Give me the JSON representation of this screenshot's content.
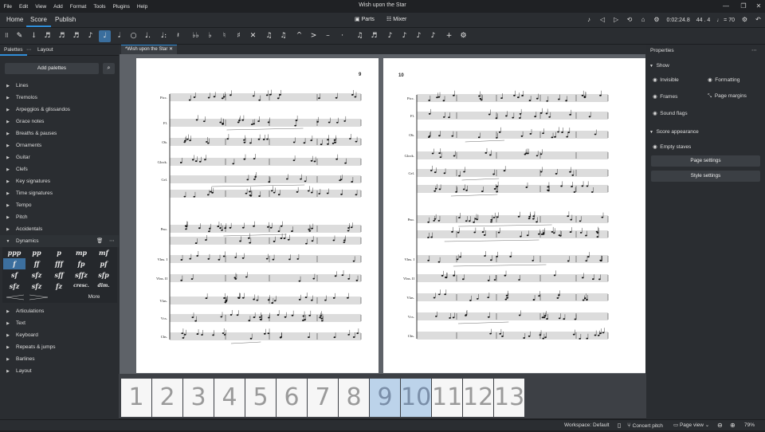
{
  "menu": [
    "File",
    "Edit",
    "View",
    "Add",
    "Format",
    "Tools",
    "Plugins",
    "Help"
  ],
  "window_title": "Wish upon the Star",
  "main_tabs": [
    "Home",
    "Score",
    "Publish"
  ],
  "top_center": {
    "parts": "Parts",
    "mixer": "Mixer"
  },
  "playback": {
    "time": "0:02:24.8",
    "measure": "44 . 4",
    "tempo": "♩ = 70"
  },
  "palettes_tab": "Palettes",
  "layout_tab": "Layout",
  "add_palettes": "Add palettes",
  "palettes": [
    "Lines",
    "Tremolos",
    "Arpeggios & glissandos",
    "Grace notes",
    "Breaths & pauses",
    "Ornaments",
    "Guitar",
    "Clefs",
    "Key signatures",
    "Time signatures",
    "Tempo",
    "Pitch",
    "Accidentals",
    "Dynamics"
  ],
  "palettes_after": [
    "Articulations",
    "Text",
    "Keyboard",
    "Repeats & jumps",
    "Barlines",
    "Layout"
  ],
  "dynamics_cells": [
    "ppp",
    "pp",
    "p",
    "mp",
    "mf",
    "f",
    "ff",
    "fff",
    "fp",
    "pf",
    "sf",
    "sfz",
    "sff",
    "sffz",
    "sfp",
    "sfz",
    "sfz",
    "fz",
    "cresc.",
    "dim."
  ],
  "dynamics_more": "More",
  "doc_tab": "*Wish upon the Star",
  "page_numbers": {
    "left": "9",
    "right": "10"
  },
  "instruments_left": [
    "Picc.",
    "Fl.",
    "Ob.",
    "Glock.",
    "Cel.",
    "Pno.",
    "Vlns. I",
    "Vlns. II",
    "Vlas.",
    "Vcs.",
    "Cbs."
  ],
  "instruments_right": [
    "Picc.",
    "Fl.",
    "Ob.",
    "Glock.",
    "Cel.",
    "Pno.",
    "Vlns. I",
    "Vlns. II",
    "Vlas.",
    "Vcs.",
    "Cbs."
  ],
  "thumbnails": [
    "1",
    "2",
    "3",
    "4",
    "5",
    "6",
    "7",
    "8",
    "9",
    "10",
    "11",
    "12",
    "13"
  ],
  "properties": {
    "title": "Properties",
    "show_header": "Show",
    "toggles": [
      "Invisible",
      "Formatting",
      "Frames",
      "Page margins",
      "Sound flags"
    ],
    "score_appearance": "Score appearance",
    "empty_staves": "Empty staves",
    "page_settings": "Page settings",
    "style_settings": "Style settings"
  },
  "status": {
    "workspace": "Workspace: Default",
    "concert_pitch": "Concert pitch",
    "view": "Page view",
    "zoom": "79%"
  },
  "colors": {
    "accent": "#2f8dd8",
    "selected": "#3c6f9e",
    "panel": "#2a2d31"
  }
}
